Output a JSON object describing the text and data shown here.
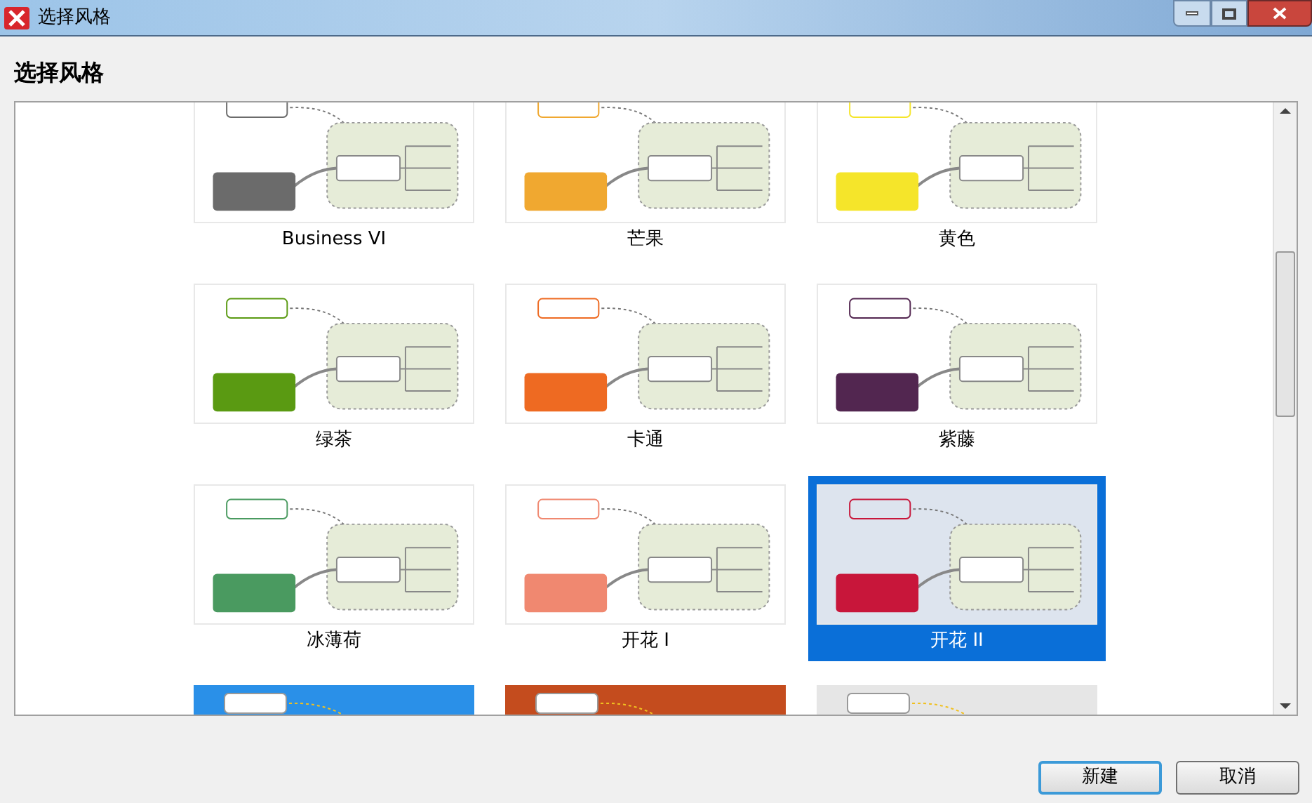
{
  "window": {
    "title": "选择风格"
  },
  "heading": "选择风格",
  "styles": [
    {
      "name": "Business VI",
      "color": "#6b6b6b",
      "selected": false
    },
    {
      "name": "芒果",
      "color": "#f0a830",
      "selected": false
    },
    {
      "name": "黄色",
      "color": "#f5e52a",
      "selected": false
    },
    {
      "name": "绿茶",
      "color": "#5a9a12",
      "selected": false
    },
    {
      "name": "卡通",
      "color": "#ee6a22",
      "selected": false
    },
    {
      "name": "紫藤",
      "color": "#522650",
      "selected": false
    },
    {
      "name": "冰薄荷",
      "color": "#4a9a60",
      "selected": false
    },
    {
      "name": "开花 I",
      "color": "#f08870",
      "selected": false
    },
    {
      "name": "开花 II",
      "color": "#c8163a",
      "selected": true
    },
    {
      "color": "#2a90e8",
      "selected": false,
      "kind": "backdrop"
    },
    {
      "color": "#c44c1e",
      "selected": false,
      "kind": "backdrop"
    },
    {
      "color": "#e6e6e6",
      "selected": false,
      "kind": "backdrop"
    }
  ],
  "buttons": [
    {
      "label": "新建",
      "kind": "default"
    },
    {
      "label": "取消",
      "kind": "normal"
    }
  ]
}
